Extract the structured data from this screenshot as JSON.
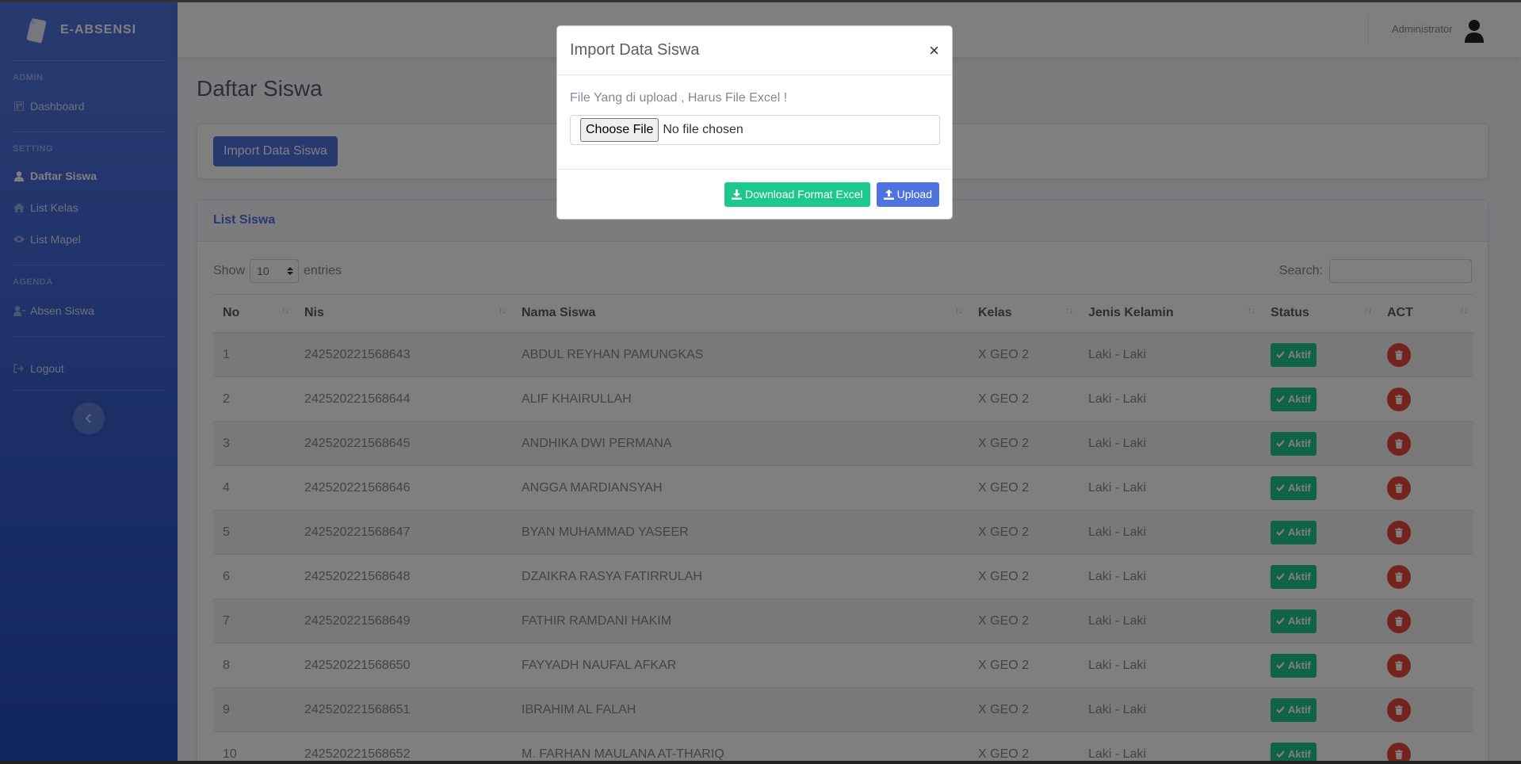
{
  "brand": {
    "name": "E-ABSENSI"
  },
  "sidebar": {
    "headings": {
      "admin": "ADMIN",
      "setting": "SETTING",
      "agenda": "AGENDA"
    },
    "items": {
      "dashboard": "Dashboard",
      "daftar_siswa": "Daftar Siswa",
      "list_kelas": "List Kelas",
      "list_mapel": "List Mapel",
      "absen_siswa": "Absen Siswa",
      "logout": "Logout"
    },
    "active": "daftar_siswa",
    "toggle_icon": "chevron-left-icon"
  },
  "topbar": {
    "user_name": "Administrator"
  },
  "page": {
    "title": "Daftar Siswa",
    "import_button": "Import Data Siswa",
    "card_title": "List Siswa",
    "show_label": "Show",
    "entries_value": "10",
    "entries_label": "entries",
    "search_label": "Search:"
  },
  "table": {
    "columns": {
      "no": "No",
      "nis": "Nis",
      "nama": "Nama Siswa",
      "kelas": "Kelas",
      "jk": "Jenis Kelamin",
      "status": "Status",
      "act": "ACT"
    },
    "status_label": "Aktif",
    "rows": [
      {
        "no": "1",
        "nis": "242520221568643",
        "nama": "ABDUL REYHAN PAMUNGKAS",
        "kelas": "X GEO 2",
        "jk": "Laki - Laki"
      },
      {
        "no": "2",
        "nis": "242520221568644",
        "nama": "ALIF KHAIRULLAH",
        "kelas": "X GEO 2",
        "jk": "Laki - Laki"
      },
      {
        "no": "3",
        "nis": "242520221568645",
        "nama": "ANDHIKA DWI PERMANA",
        "kelas": "X GEO 2",
        "jk": "Laki - Laki"
      },
      {
        "no": "4",
        "nis": "242520221568646",
        "nama": "ANGGA MARDIANSYAH",
        "kelas": "X GEO 2",
        "jk": "Laki - Laki"
      },
      {
        "no": "5",
        "nis": "242520221568647",
        "nama": "BYAN MUHAMMAD YASEER",
        "kelas": "X GEO 2",
        "jk": "Laki - Laki"
      },
      {
        "no": "6",
        "nis": "242520221568648",
        "nama": "DZAIKRA RASYA FATIRRULAH",
        "kelas": "X GEO 2",
        "jk": "Laki - Laki"
      },
      {
        "no": "7",
        "nis": "242520221568649",
        "nama": "FATHIR RAMDANI HAKIM",
        "kelas": "X GEO 2",
        "jk": "Laki - Laki"
      },
      {
        "no": "8",
        "nis": "242520221568650",
        "nama": "FAYYADH NAUFAL AFKAR",
        "kelas": "X GEO 2",
        "jk": "Laki - Laki"
      },
      {
        "no": "9",
        "nis": "242520221568651",
        "nama": "IBRAHIM AL FALAH",
        "kelas": "X GEO 2",
        "jk": "Laki - Laki"
      },
      {
        "no": "10",
        "nis": "242520221568652",
        "nama": "M. FARHAN MAULANA AT-THARIQ",
        "kelas": "X GEO 2",
        "jk": "Laki - Laki"
      }
    ]
  },
  "modal": {
    "title": "Import Data Siswa",
    "close": "×",
    "label": "File Yang di upload , Harus File Excel !",
    "file_button": "Choose File",
    "file_status": "No file chosen",
    "download_button": "Download Format Excel",
    "upload_button": "Upload"
  },
  "colors": {
    "primary": "#4e73df",
    "success": "#1cc88a",
    "danger": "#e74a3b"
  }
}
